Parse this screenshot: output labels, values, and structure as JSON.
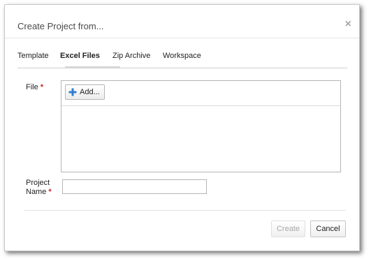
{
  "dialog": {
    "title": "Create Project from...",
    "close_glyph": "×"
  },
  "tabs": [
    {
      "label": "Template",
      "active": false
    },
    {
      "label": "Excel Files",
      "active": true
    },
    {
      "label": "Zip Archive",
      "active": false
    },
    {
      "label": "Workspace",
      "active": false
    }
  ],
  "form": {
    "file_label": "File",
    "required_marker": "*",
    "add_button_label": "Add...",
    "add_icon": "plus-icon",
    "project_name_label_line1": "Project",
    "project_name_label_line2": "Name",
    "project_name_value": ""
  },
  "footer": {
    "create_label": "Create",
    "create_disabled": true,
    "cancel_label": "Cancel"
  },
  "colors": {
    "required": "#cc2222",
    "plus_icon": "#2f7fd0",
    "disabled_text": "#a9a9a9"
  }
}
